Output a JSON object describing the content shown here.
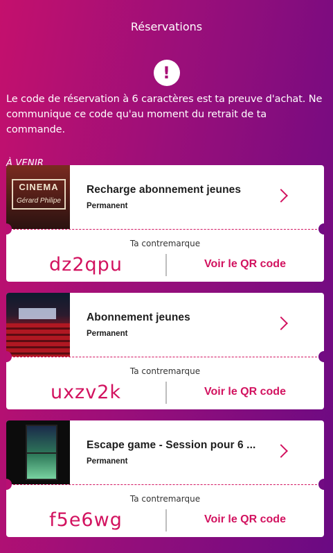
{
  "header": {
    "title": "Réservations"
  },
  "alert": {
    "glyph": "!"
  },
  "info": {
    "text": "Le code de réservation à 6 caractères est ta preuve d'achat. Ne communique ce code qu'au moment du retrait de ta commande."
  },
  "section": {
    "title": "À VENIR"
  },
  "reservations": [
    {
      "title": "Recharge abonnement jeunes",
      "subtitle": "Permanent",
      "code_label": "Ta contremarque",
      "code": "dz2qpu",
      "qr_label": "Voir le QR code",
      "image_text": "CINEMA",
      "image_sub": "Gérard Philipe"
    },
    {
      "title": "Abonnement jeunes",
      "subtitle": "Permanent",
      "code_label": "Ta contremarque",
      "code": "uxzv2k",
      "qr_label": "Voir le QR code"
    },
    {
      "title": "Escape game - Session pour 6 ...",
      "subtitle": "Permanent",
      "code_label": "Ta contremarque",
      "code": "f5e6wg",
      "qr_label": "Voir le QR code"
    }
  ],
  "colors": {
    "accent": "#d2125f",
    "gradient_start": "#c4106d",
    "gradient_end": "#6a0a83"
  },
  "icons": {
    "alert": "exclamation-circle-icon",
    "chevron": "chevron-right-icon"
  }
}
